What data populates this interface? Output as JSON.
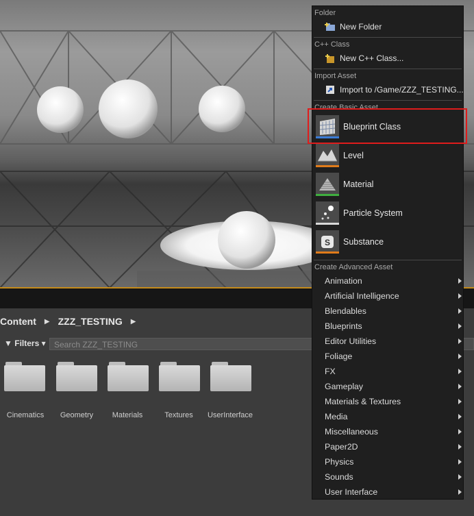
{
  "breadcrumb": {
    "root": "Content",
    "folder": "ZZZ_TESTING"
  },
  "filters": {
    "label": "Filters",
    "search_placeholder": "Search ZZZ_TESTING"
  },
  "folders": [
    "Cinematics",
    "Geometry",
    "Materials",
    "Textures",
    "UserInterface"
  ],
  "menu": {
    "folder_section": "Folder",
    "new_folder": "New Folder",
    "cpp_section": "C++ Class",
    "new_cpp": "New C++ Class...",
    "import_section": "Import Asset",
    "import_to": "Import to /Game/ZZZ_TESTING...",
    "basic_section": "Create Basic Asset",
    "basic_items": [
      {
        "label": "Blueprint Class",
        "icon": "blueprint-icon",
        "color": "#3a7bd5"
      },
      {
        "label": "Level",
        "icon": "level-icon",
        "color": "#e07b1a"
      },
      {
        "label": "Material",
        "icon": "material-icon",
        "color": "#3fae3f"
      },
      {
        "label": "Particle System",
        "icon": "particle-icon",
        "color": "#d8d8d8"
      },
      {
        "label": "Substance",
        "icon": "substance-icon",
        "color": "#e07b1a"
      }
    ],
    "advanced_section": "Create Advanced Asset",
    "advanced_items": [
      "Animation",
      "Artificial Intelligence",
      "Blendables",
      "Blueprints",
      "Editor Utilities",
      "Foliage",
      "FX",
      "Gameplay",
      "Materials & Textures",
      "Media",
      "Miscellaneous",
      "Paper2D",
      "Physics",
      "Sounds",
      "User Interface"
    ]
  },
  "colors": {
    "highlight": "#e01c1c",
    "accent": "#c48a1a"
  }
}
